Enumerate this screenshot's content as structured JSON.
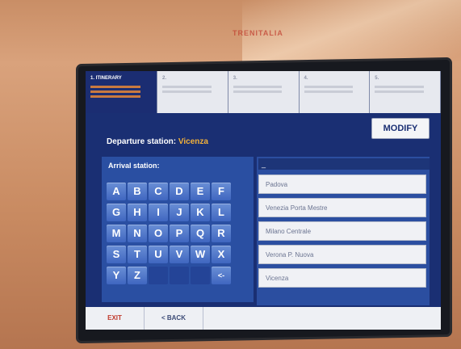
{
  "kiosk": {
    "brand": "TRENITALIA"
  },
  "steps": [
    {
      "label": "1. ITINERARY"
    },
    {
      "label": "2."
    },
    {
      "label": "3."
    },
    {
      "label": "4."
    },
    {
      "label": "5."
    }
  ],
  "modify_label": "MODIFY",
  "departure": {
    "label": "Departure station:",
    "value": "Vicenza"
  },
  "arrival": {
    "label": "Arrival station:",
    "input_value": "_"
  },
  "keyboard": {
    "keys": [
      "A",
      "B",
      "C",
      "D",
      "E",
      "F",
      "G",
      "H",
      "I",
      "J",
      "K",
      "L",
      "M",
      "N",
      "O",
      "P",
      "Q",
      "R",
      "S",
      "T",
      "U",
      "V",
      "W",
      "X",
      "Y",
      "Z",
      "",
      "",
      "",
      "<-"
    ]
  },
  "stations": [
    "Padova",
    "Venezia Porta Mestre",
    "Milano Centrale",
    "Verona P. Nuova",
    "Vicenza"
  ],
  "bottom": {
    "exit_label": "EXIT",
    "back_label": "< BACK"
  }
}
